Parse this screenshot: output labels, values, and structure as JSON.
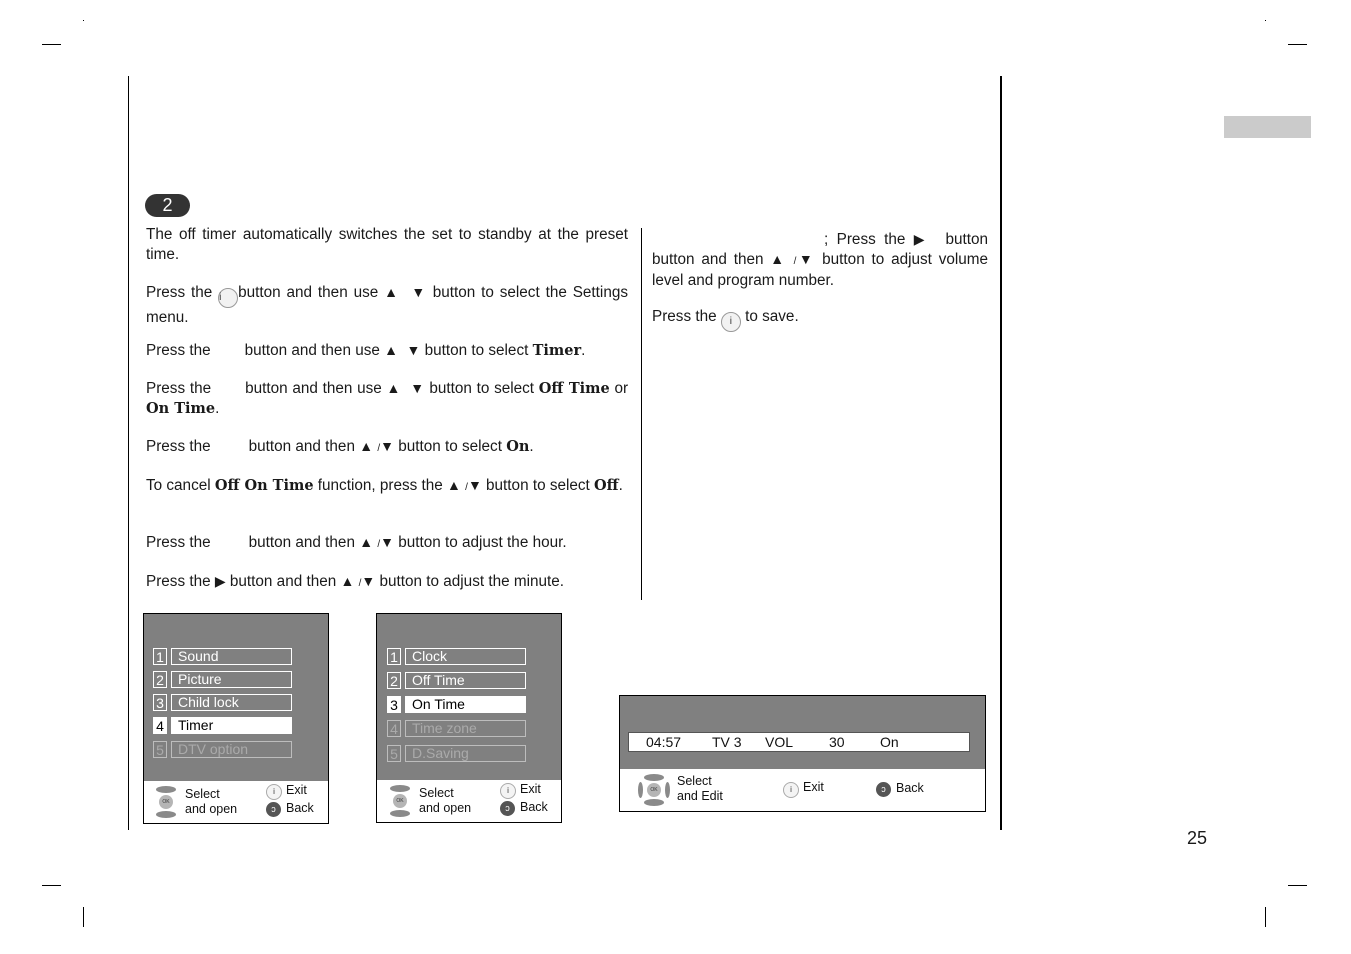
{
  "step": {
    "number": "2"
  },
  "page_number": "25",
  "left_column": {
    "intro": "The off timer automatically switches the set to standby at the preset time.",
    "p1": {
      "a": "Press the",
      "icon": "i",
      "b": "button and then use",
      "c": "button to select the Settings menu."
    },
    "p2": {
      "a": "Press the",
      "b": "button and then use",
      "c": "button to select",
      "bold": "Timer",
      "end": "."
    },
    "p3": {
      "a": "Press the",
      "b": "button and then use",
      "c": "button to select",
      "bold1": "Off Time",
      "mid": "or",
      "bold2": "On Time",
      "end": "."
    },
    "p4": {
      "a": "Press the",
      "b": "button and then",
      "c": "button to select",
      "bold": "On",
      "end": "."
    },
    "p5": {
      "a": "To cancel",
      "bold1": "Off On Time",
      "b": "function, press the",
      "c": "button to select",
      "bold2": "Off",
      "end": "."
    },
    "p6": {
      "a": "Press the",
      "b": "button and then",
      "c": "button to adjust the hour."
    },
    "p7": {
      "a": "Press the",
      "b": "button and then",
      "c": "button to adjust the minute."
    }
  },
  "right_column": {
    "p1": {
      "a": "; Press the",
      "b": "button and then",
      "c": "button to adjust volume level and program number."
    },
    "p2": {
      "a": "Press the",
      "icon": "i",
      "b": "to save."
    }
  },
  "glyphs": {
    "up": "▲",
    "down": "▼",
    "right": "▶",
    "slash": "/",
    "back": "ↄ",
    "info": "i",
    "ok": "OK"
  },
  "osd_settings": {
    "items": [
      {
        "num": "1",
        "label": "Sound",
        "state": "normal"
      },
      {
        "num": "2",
        "label": "Picture",
        "state": "normal"
      },
      {
        "num": "3",
        "label": "Child lock",
        "state": "normal"
      },
      {
        "num": "4",
        "label": "Timer",
        "state": "selected"
      },
      {
        "num": "5",
        "label": "DTV option",
        "state": "disabled"
      }
    ],
    "footer": {
      "nav_line1": "Select",
      "nav_line2": "and open",
      "exit": "Exit",
      "back": "Back"
    }
  },
  "osd_timer": {
    "items": [
      {
        "num": "1",
        "label": "Clock",
        "state": "normal"
      },
      {
        "num": "2",
        "label": "Off Time",
        "state": "normal"
      },
      {
        "num": "3",
        "label": "On Time",
        "state": "selected"
      },
      {
        "num": "4",
        "label": "Time zone",
        "state": "disabled"
      },
      {
        "num": "5",
        "label": "D.Saving",
        "state": "disabled"
      }
    ],
    "footer": {
      "nav_line1": "Select",
      "nav_line2": "and open",
      "exit": "Exit",
      "back": "Back"
    }
  },
  "osd_ontime": {
    "fields": {
      "time": "04:57",
      "input": "TV 3",
      "vol_label": "VOL",
      "vol_value": "30",
      "state": "On"
    },
    "footer": {
      "nav_line1": "Select",
      "nav_line2": "and Edit",
      "exit": "Exit",
      "back": "Back"
    }
  },
  "colors": {
    "osd_bg": "#808080",
    "tab_marker": "#cbcbcb",
    "badge": "#333333"
  }
}
